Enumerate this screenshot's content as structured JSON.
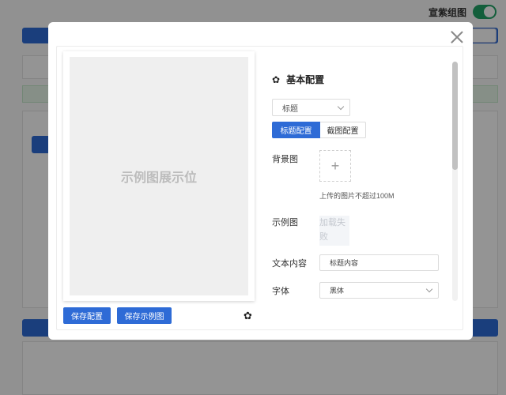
{
  "background": {
    "toggle_label": "宣紫组图"
  },
  "modal": {
    "preview_placeholder": "示例图展示位",
    "save_config_label": "保存配置",
    "save_sample_label": "保存示例图",
    "section_title": "基本配置",
    "type_select_value": "标题",
    "tabs": [
      {
        "label": "标题配置",
        "active": true
      },
      {
        "label": "截图配置",
        "active": false
      }
    ],
    "background_label": "背景图",
    "upload_plus": "+",
    "upload_hint": "上传的图片不超过100M",
    "sample_label": "示例图",
    "image_fail_text": "加载失败",
    "text_content_label": "文本内容",
    "text_content_value": "标题内容",
    "font_label": "字体",
    "font_value": "黑体"
  },
  "colors": {
    "primary": "#2e6bd6",
    "toggle_on": "#21a366"
  }
}
